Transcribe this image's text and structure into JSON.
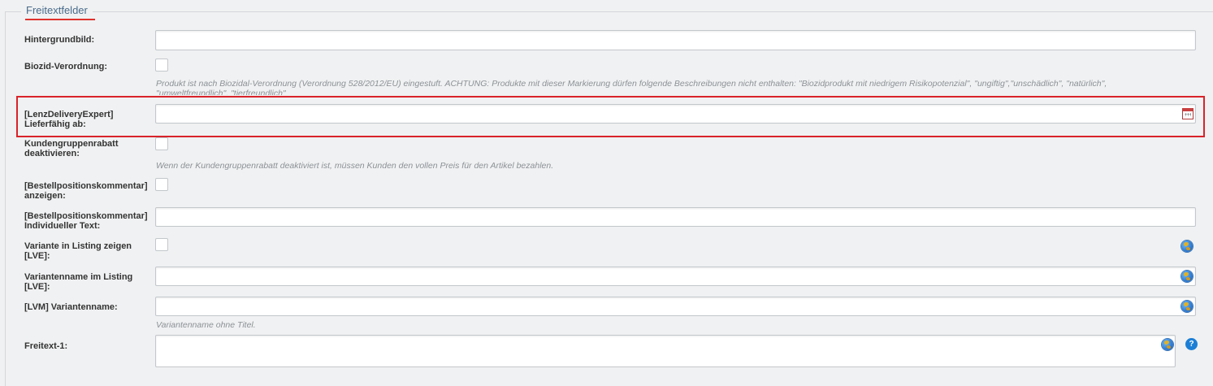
{
  "fieldset": {
    "legend": "Freitextfelder"
  },
  "fields": {
    "hintergrundbild": {
      "label": "Hintergrundbild:",
      "value": ""
    },
    "biozid": {
      "label": "Biozid-Verordnung:",
      "help": "Produkt ist nach Biozidal-Verordnung (Verordnung 528/2012/EU) eingestuft. ACHTUNG: Produkte mit dieser Markierung dürfen folgende Beschreibungen nicht enthalten: \"Biozidprodukt mit niedrigem Risikopotenzial\", \"ungiftig\",\"unschädlich\", \"natürlich\", \"umweltfreundlich\", \"tierfreundlich\""
    },
    "lieferfaehig": {
      "label_line1": "[LenzDeliveryExpert]",
      "label_line2": "Lieferfähig ab:",
      "value": ""
    },
    "kundengruppenrabatt": {
      "label_line1": "Kundengruppenrabatt",
      "label_line2": "deaktivieren:",
      "help": "Wenn der Kundengruppenrabatt deaktiviert ist, müssen Kunden den vollen Preis für den Artikel bezahlen."
    },
    "bestellpos_anzeigen": {
      "label_line1": "[Bestellpositionskommentar]",
      "label_line2": "anzeigen:"
    },
    "bestellpos_text": {
      "label_line1": "[Bestellpositionskommentar]",
      "label_line2": "Individueller Text:",
      "value": ""
    },
    "variante_listing": {
      "label_line1": "Variante in Listing zeigen",
      "label_line2": "[LVE]:"
    },
    "variantenname_listing": {
      "label_line1": "Variantenname im Listing",
      "label_line2": "[LVE]:",
      "value": ""
    },
    "lvm_variantenname": {
      "label": "[LVM] Variantenname:",
      "value": "",
      "help": "Variantenname ohne Titel."
    },
    "freitext1": {
      "label": "Freitext-1:",
      "value": ""
    }
  },
  "icons": {
    "translate": "globe-icon",
    "calendar": "calendar-icon",
    "help": "question-icon",
    "help_glyph": "?"
  },
  "colors": {
    "highlight": "#d9232a",
    "legend": "#4a6c8c",
    "accent": "#1c7fd6"
  }
}
